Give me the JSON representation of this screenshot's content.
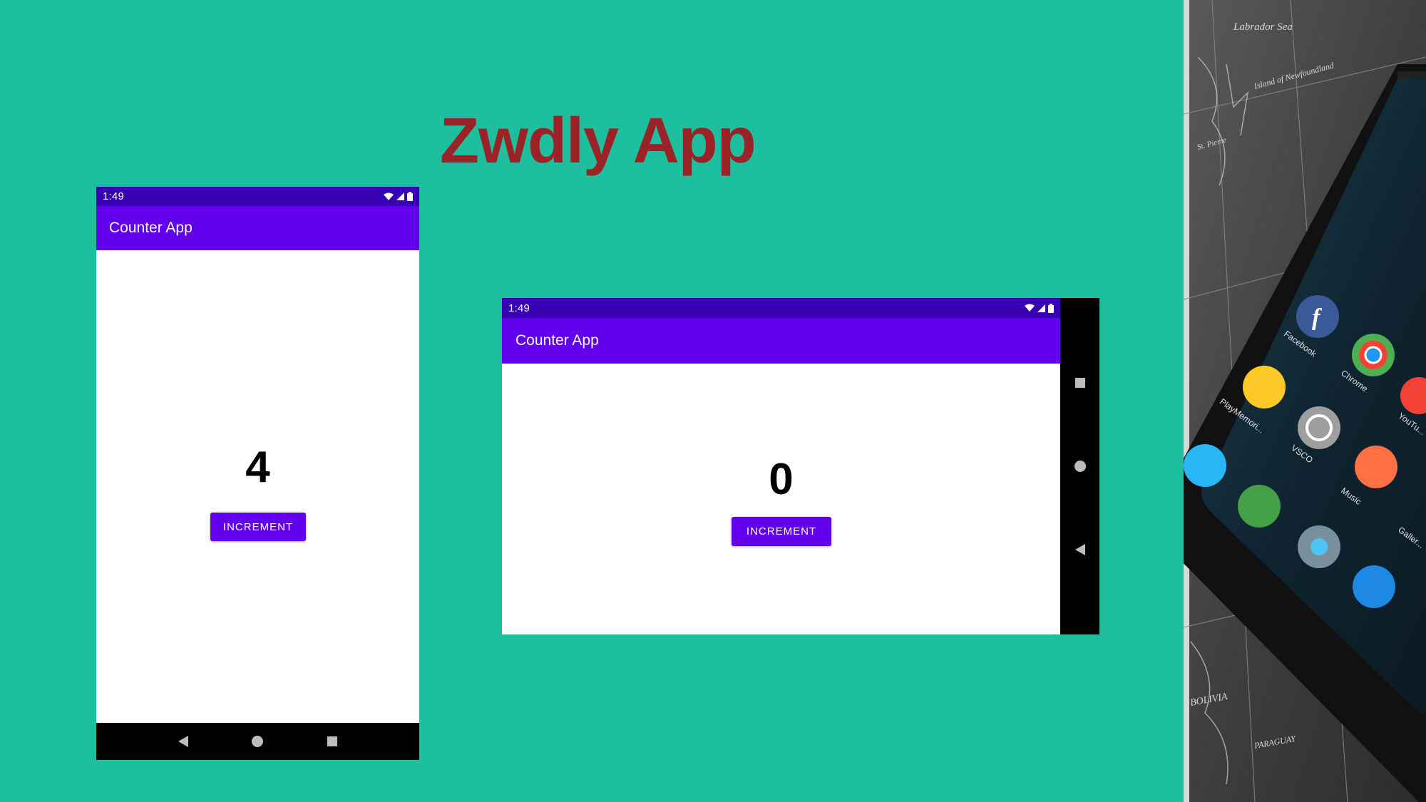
{
  "slide": {
    "title": "Zwdly App"
  },
  "portrait_phone": {
    "status_time": "1:49",
    "app_title": "Counter App",
    "count": "4",
    "button_label": "INCREMENT"
  },
  "landscape_phone": {
    "status_time": "1:49",
    "app_title": "Counter App",
    "count": "0",
    "button_label": "INCREMENT"
  },
  "photo": {
    "app_labels": [
      "Facebook",
      "Chrome",
      "PlayMemori...",
      "VSCO",
      "YouTu...",
      "Music",
      "Galler..."
    ],
    "map_labels": [
      "Labrador Sea",
      "Island of Newfoundland",
      "St. Pierre",
      "BOLIVIA",
      "PARAGUAY"
    ]
  },
  "colors": {
    "background": "#1DBF9F",
    "title": "#9B2226",
    "status_bar": "#3700B3",
    "app_bar": "#6200EE",
    "button": "#6200EE",
    "nav_bar": "#000000"
  },
  "icons": {
    "wifi": "wifi-icon",
    "signal": "signal-icon",
    "battery": "battery-icon",
    "back": "back-triangle-icon",
    "home": "home-circle-icon",
    "recents": "recents-square-icon"
  }
}
